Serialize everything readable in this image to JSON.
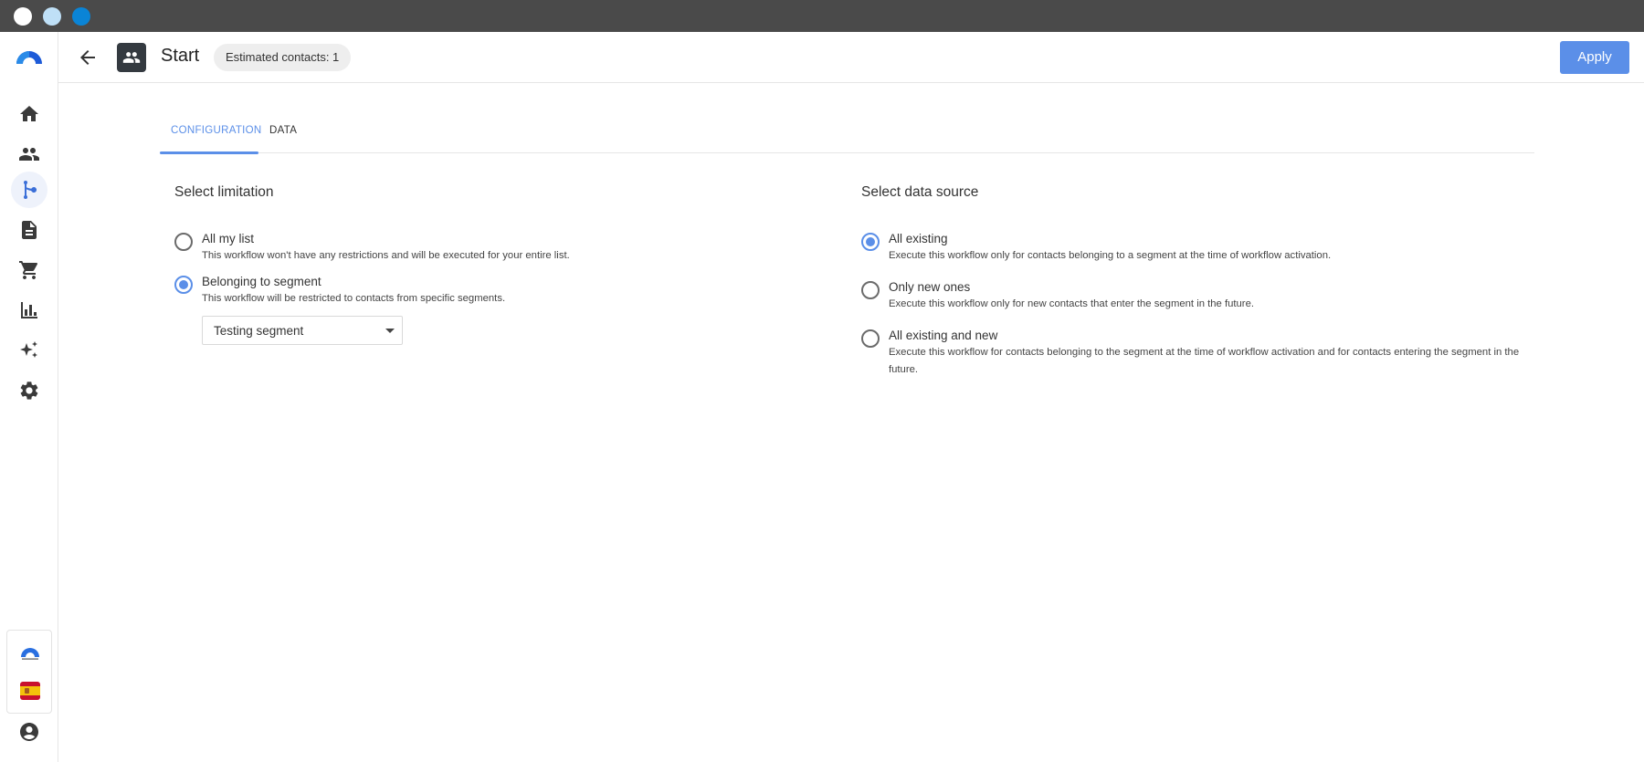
{
  "window": {
    "controls": [
      "close",
      "minimize",
      "maximize"
    ]
  },
  "sidebar": {
    "logo": "brand-logo",
    "items": [
      {
        "icon": "home-icon",
        "active": false
      },
      {
        "icon": "contacts-icon",
        "active": false
      },
      {
        "icon": "workflow-icon",
        "active": true
      },
      {
        "icon": "document-icon",
        "active": false
      },
      {
        "icon": "cart-icon",
        "active": false
      },
      {
        "icon": "chart-icon",
        "active": false
      },
      {
        "icon": "sparkle-icon",
        "active": false
      },
      {
        "icon": "gear-icon",
        "active": false
      }
    ],
    "language_flag": "spain-flag",
    "profile_icon": "account-icon"
  },
  "header": {
    "title": "Start",
    "badge": "Estimated contacts: 1",
    "apply_label": "Apply"
  },
  "tabs": [
    {
      "label": "CONFIGURATION",
      "active": true
    },
    {
      "label": "DATA",
      "active": false
    }
  ],
  "limitation": {
    "title": "Select limitation",
    "options": [
      {
        "label": "All my list",
        "description": "This workflow won't have any restrictions and will be executed for your entire list.",
        "checked": false
      },
      {
        "label": "Belonging to segment",
        "description": "This workflow will be restricted to contacts from specific segments.",
        "checked": true
      }
    ],
    "segment_select": {
      "value": "Testing segment"
    }
  },
  "data_source": {
    "title": "Select data source",
    "options": [
      {
        "label": "All existing",
        "description": "Execute this workflow only for contacts belonging to a segment at the time of workflow activation.",
        "checked": true
      },
      {
        "label": "Only new ones",
        "description": "Execute this workflow only for new contacts that enter the segment in the future.",
        "checked": false
      },
      {
        "label": "All existing and new",
        "description": "Execute this workflow for contacts belonging to the segment at the time of workflow activation and for contacts entering the segment in the future.",
        "checked": false
      }
    ]
  },
  "colors": {
    "accent": "#5b8fe8",
    "title_bar": "#4a4a4a",
    "icon_dark": "#343a40"
  }
}
